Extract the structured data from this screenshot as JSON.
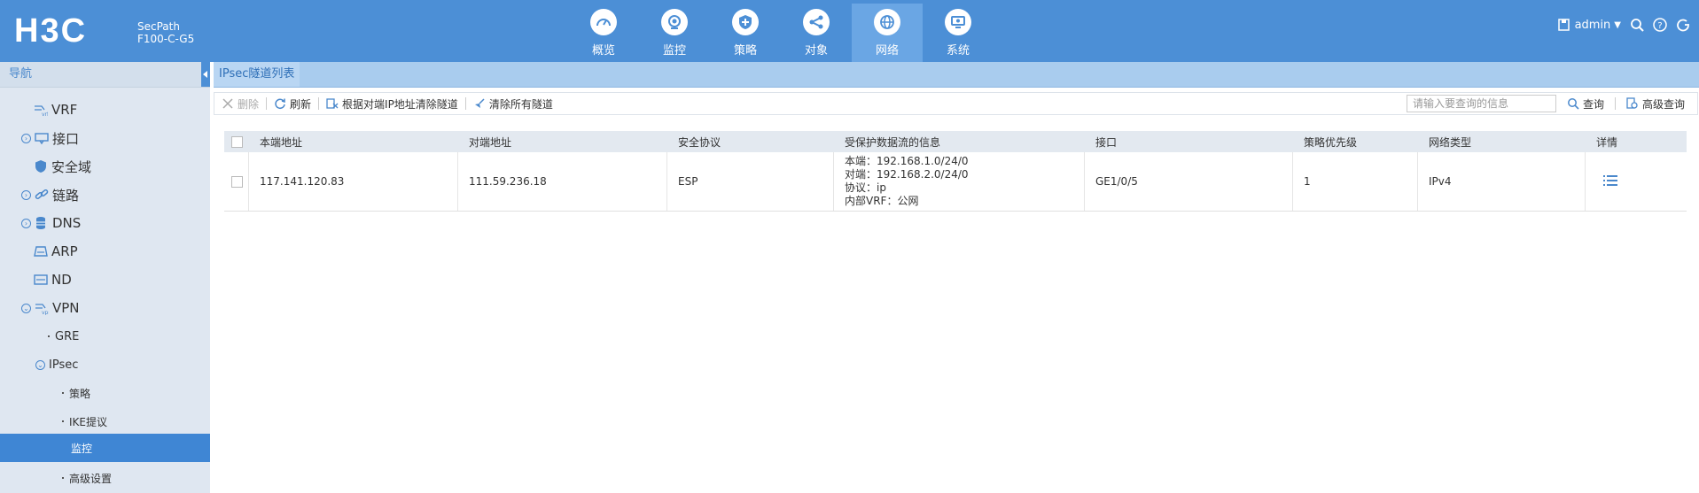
{
  "header": {
    "product_line1": "SecPath",
    "product_line2": "F100-C-G5",
    "nav": [
      {
        "label": "概览",
        "icon": "dashboard-icon"
      },
      {
        "label": "监控",
        "icon": "monitor-icon"
      },
      {
        "label": "策略",
        "icon": "shield-icon"
      },
      {
        "label": "对象",
        "icon": "share-icon"
      },
      {
        "label": "网络",
        "icon": "globe-icon",
        "active": true
      },
      {
        "label": "系统",
        "icon": "system-icon"
      }
    ],
    "user": "admin",
    "brand_color": "#4c8fd6"
  },
  "sidebar": {
    "title": "导航",
    "items": [
      {
        "label": "VRF",
        "icon": "vrf-icon"
      },
      {
        "label": "接口",
        "icon": "interface-icon",
        "expandable": true
      },
      {
        "label": "安全域",
        "icon": "security-zone-icon"
      },
      {
        "label": "链路",
        "icon": "link-icon",
        "expandable": true
      },
      {
        "label": "DNS",
        "icon": "dns-icon",
        "expandable": true
      },
      {
        "label": "ARP",
        "icon": "arp-icon"
      },
      {
        "label": "ND",
        "icon": "nd-icon"
      },
      {
        "label": "VPN",
        "icon": "vpn-icon",
        "expanded": true
      },
      {
        "label": "GRE"
      },
      {
        "label": "IPsec",
        "expanded": true
      },
      {
        "label": "策略"
      },
      {
        "label": "IKE提议"
      },
      {
        "label": "监控",
        "active": true
      },
      {
        "label": "高级设置"
      }
    ]
  },
  "main": {
    "tab": "IPsec隧道列表",
    "toolbar": {
      "delete": "删除",
      "refresh": "刷新",
      "clear_by_ip": "根据对端IP地址清除隧道",
      "clear_all": "清除所有隧道",
      "search_placeholder": "请输入要查询的信息",
      "query": "查询",
      "advanced_query": "高级查询"
    },
    "table": {
      "headers": [
        "本端地址",
        "对端地址",
        "安全协议",
        "受保护数据流的信息",
        "接口",
        "策略优先级",
        "网络类型",
        "详情"
      ],
      "rows": [
        {
          "local": "117.141.120.83",
          "peer": "111.59.236.18",
          "protocol": "ESP",
          "flow": [
            "本端：192.168.1.0/24/0",
            "对端：192.168.2.0/24/0",
            "协议：ip",
            "内部VRF：公网"
          ],
          "interface": "GE1/0/5",
          "priority": "1",
          "net_type": "IPv4"
        }
      ]
    }
  }
}
